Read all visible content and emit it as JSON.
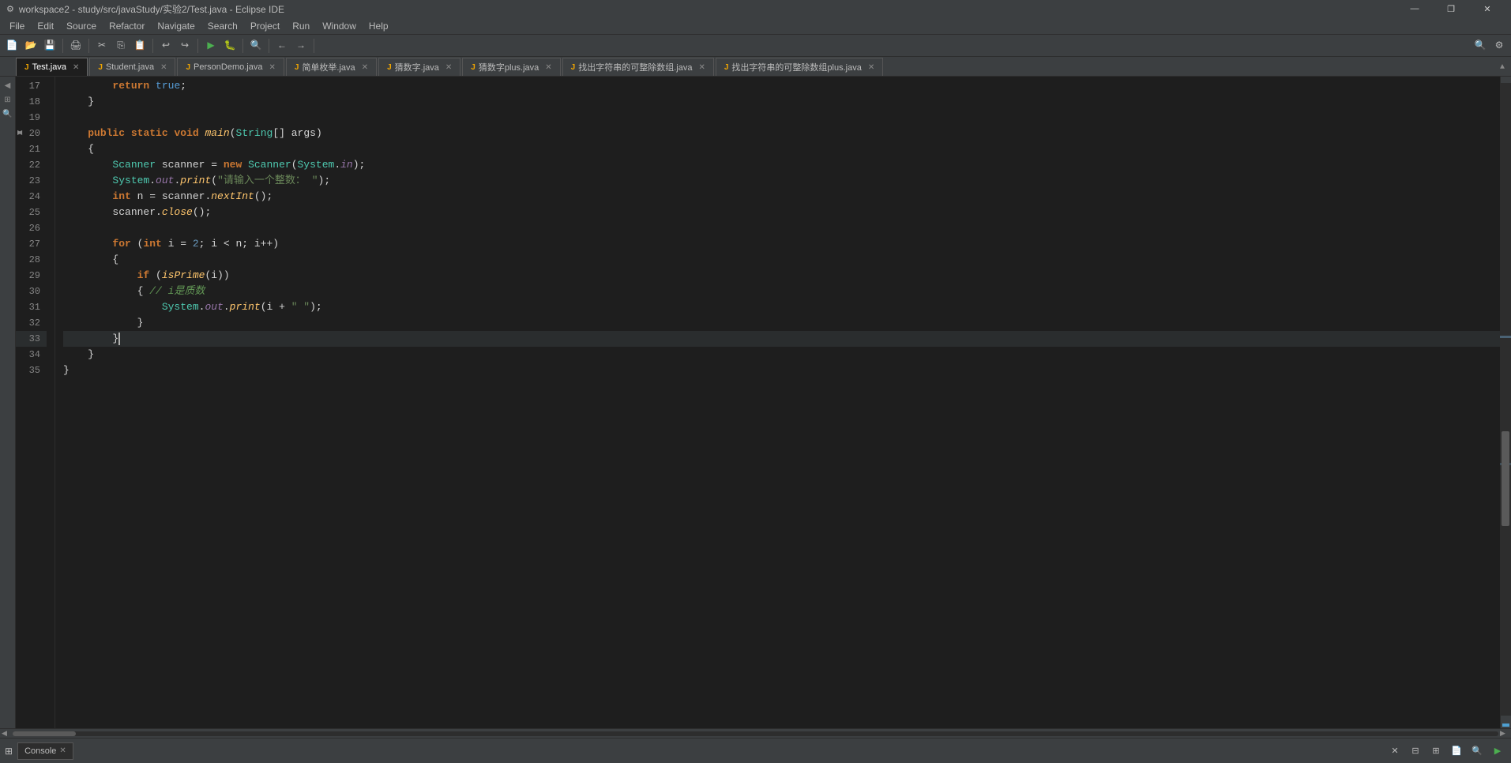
{
  "titleBar": {
    "title": "workspace2 - study/src/javaStudy/实验2/Test.java - Eclipse IDE",
    "minBtn": "—",
    "maxBtn": "❐",
    "closeBtn": "✕"
  },
  "menuBar": {
    "items": [
      "File",
      "Edit",
      "Source",
      "Refactor",
      "Navigate",
      "Search",
      "Project",
      "Run",
      "Window",
      "Help"
    ]
  },
  "tabs": [
    {
      "label": "Test.java",
      "icon": "J",
      "active": true,
      "dirty": false
    },
    {
      "label": "Student.java",
      "icon": "J",
      "active": false,
      "dirty": false
    },
    {
      "label": "PersonDemo.java",
      "icon": "J",
      "active": false,
      "dirty": false
    },
    {
      "label": "简单枚举.java",
      "icon": "J",
      "active": false,
      "dirty": false
    },
    {
      "label": "猜数字.java",
      "icon": "J",
      "active": false,
      "dirty": false
    },
    {
      "label": "猜数字plus.java",
      "icon": "J",
      "active": false,
      "dirty": false
    },
    {
      "label": "找出字符串的可整除数组.java",
      "icon": "J",
      "active": false,
      "dirty": false
    },
    {
      "label": "找出字符串的可整除数组plus.java",
      "icon": "J",
      "active": false,
      "dirty": false
    }
  ],
  "lineNumbers": [
    17,
    18,
    19,
    20,
    21,
    22,
    23,
    24,
    25,
    26,
    27,
    28,
    29,
    30,
    31,
    32,
    33,
    34,
    35
  ],
  "bottomTab": {
    "label": "Console",
    "icon": "⊞"
  },
  "colors": {
    "keyword": "#cc7832",
    "keyword2": "#569cd6",
    "string": "#6a8759",
    "comment": "#629755",
    "method": "#ffc66d",
    "number": "#6897bb",
    "field": "#9876aa",
    "type": "#4ec9b0",
    "plain": "#d4d4d4",
    "background": "#1e1e1e",
    "lineHighlight": "#2a2d2e"
  }
}
